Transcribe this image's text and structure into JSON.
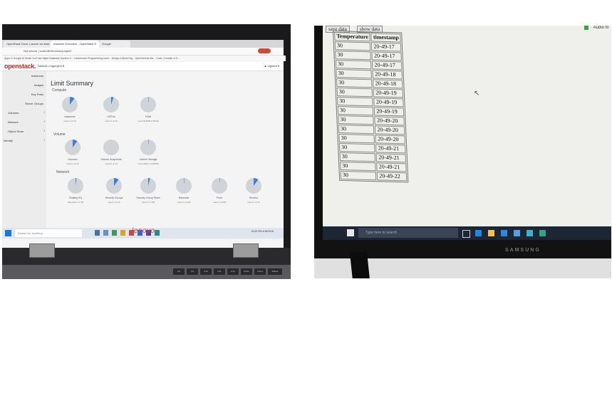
{
  "left_photo": {
    "browser": {
      "tabs": [
        "OpenStack Docs: Launch an insta",
        "Instance Overview - OpenStack D",
        "Google"
      ],
      "url": "Not secure | controller/horizon/project/",
      "bookmarks": "Apps  G Google  M Gmail  YouTube  Maps  Database System C...  Hackerrank  Programming tutori...  Design & Build Hig...  OpenNebula Ma...  Code, Compile & R...",
      "profile_label": "Paused"
    },
    "openstack": {
      "logo": "openstack.",
      "project_selector": "Default • mgproject ▾",
      "user_menu": "▲ mgvera ▾",
      "sidebar": [
        {
          "label": "Instances"
        },
        {
          "label": "Images"
        },
        {
          "label": "Key Pairs"
        },
        {
          "label": "Server Groups"
        },
        {
          "label": "Volumes"
        },
        {
          "label": "Network"
        },
        {
          "label": "Object Store"
        },
        {
          "label": "Identity"
        }
      ],
      "page_title": "Limit Summary",
      "sections": {
        "compute": "Compute",
        "volume": "Volume",
        "network": "Network"
      },
      "compute_pies": [
        {
          "label": "Instances",
          "used": "Used 1 of 10",
          "fraction": 0.1
        },
        {
          "label": "VCPUs",
          "used": "Used 1 of 20",
          "fraction": 0.05
        },
        {
          "label": "RAM",
          "used": "Used 512MB of 50GB",
          "fraction": 0.01
        }
      ],
      "volume_pies": [
        {
          "label": "Volumes",
          "used": "Used 1 of 10",
          "fraction": 0.1
        },
        {
          "label": "Volume Snapshots",
          "used": "Used 0 of 10",
          "fraction": 0
        },
        {
          "label": "Volume Storage",
          "used": "Used 1GB of 1000GB",
          "fraction": 0.001
        }
      ],
      "network_pies": [
        {
          "label": "Floating IPs",
          "used": "Allocated 1 of 50",
          "fraction": 0.02
        },
        {
          "label": "Security Groups",
          "used": "Used 1 of 10",
          "fraction": 0.1
        },
        {
          "label": "Security Group Rules",
          "used": "Used 4 of 100",
          "fraction": 0.04
        },
        {
          "label": "Networks",
          "used": "Used 1 of 100",
          "fraction": 0.01
        },
        {
          "label": "Ports",
          "used": "Used 1 of 500",
          "fraction": 0.002
        },
        {
          "label": "Routers",
          "used": "Used 1 of 10",
          "fraction": 0.1
        }
      ]
    },
    "taskbar": {
      "search_placeholder": "Search for anything",
      "clock": "10:23 PM\n4/16/2019"
    },
    "brand": "lenovo",
    "keys": [
      "F8",
      "F9",
      "F10",
      "F11",
      "F12",
      "PrtSc",
      "Insert",
      "Delete"
    ]
  },
  "right_photo": {
    "buttons": {
      "save": "save data",
      "show": "show data"
    },
    "corner_text": "Audio fil",
    "table": {
      "headers": [
        "Temperature",
        "timestamp"
      ],
      "rows": [
        [
          "30",
          "20-49-17"
        ],
        [
          "30",
          "20-49-17"
        ],
        [
          "30",
          "20-49-17"
        ],
        [
          "30",
          "20-49-18"
        ],
        [
          "30",
          "20-49-18"
        ],
        [
          "30",
          "20-49-19"
        ],
        [
          "30",
          "20-49-19"
        ],
        [
          "30",
          "20-49-19"
        ],
        [
          "30",
          "20-49-20"
        ],
        [
          "30",
          "20-49-20"
        ],
        [
          "30",
          "20-49-20"
        ],
        [
          "30",
          "20-49-21"
        ],
        [
          "30",
          "20-49-21"
        ],
        [
          "30",
          "20-49-21"
        ],
        [
          "30",
          "20-49-22"
        ]
      ]
    },
    "taskbar": {
      "search_placeholder": "Type here to search"
    },
    "brand": "SAMSUNG"
  },
  "colors": {
    "openstack_red": "#c62828",
    "pie_fill": "#d0d3d8",
    "pie_used": "#3f7fd6"
  }
}
